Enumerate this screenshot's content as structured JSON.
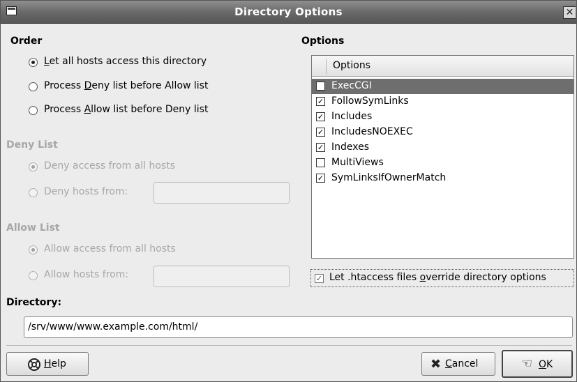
{
  "window": {
    "title": "Directory Options",
    "close_glyph": "✕"
  },
  "order": {
    "heading": "Order",
    "options": [
      {
        "pre": "",
        "key": "L",
        "post": "et all hosts access this directory",
        "selected": true
      },
      {
        "pre": "Process ",
        "key": "D",
        "post": "eny list before Allow list",
        "selected": false
      },
      {
        "pre": "Process ",
        "key": "A",
        "post": "llow list before Deny list",
        "selected": false
      }
    ]
  },
  "deny": {
    "heading": "Deny List",
    "all_label": "Deny access from all hosts",
    "from_label": "Deny hosts from:",
    "from_value": ""
  },
  "allow": {
    "heading": "Allow List",
    "all_label": "Allow access from all hosts",
    "from_label": "Allow hosts from:",
    "from_value": ""
  },
  "options": {
    "heading": "Options",
    "column_header": "Options",
    "items": [
      {
        "label": "ExecCGI",
        "checked": false,
        "selected": true
      },
      {
        "label": "FollowSymLinks",
        "checked": true,
        "selected": false
      },
      {
        "label": "Includes",
        "checked": true,
        "selected": false
      },
      {
        "label": "IncludesNOEXEC",
        "checked": true,
        "selected": false
      },
      {
        "label": "Indexes",
        "checked": true,
        "selected": false
      },
      {
        "label": "MultiViews",
        "checked": false,
        "selected": false
      },
      {
        "label": "SymLinksIfOwnerMatch",
        "checked": true,
        "selected": false
      }
    ],
    "htaccess": {
      "pre": "Let .htaccess files ",
      "key": "o",
      "post": "verride directory options",
      "checked": true
    }
  },
  "directory": {
    "heading": "Directory:",
    "value": "/srv/www/www.example.com/html/"
  },
  "buttons": {
    "help": {
      "key": "H",
      "post": "elp",
      "icon": "lifebuoy-icon"
    },
    "cancel": {
      "key": "C",
      "post": "ancel",
      "icon": "cancel-x-icon"
    },
    "ok": {
      "key": "O",
      "post": "K",
      "icon": "ok-hand-icon"
    }
  },
  "check_glyph": "✓"
}
